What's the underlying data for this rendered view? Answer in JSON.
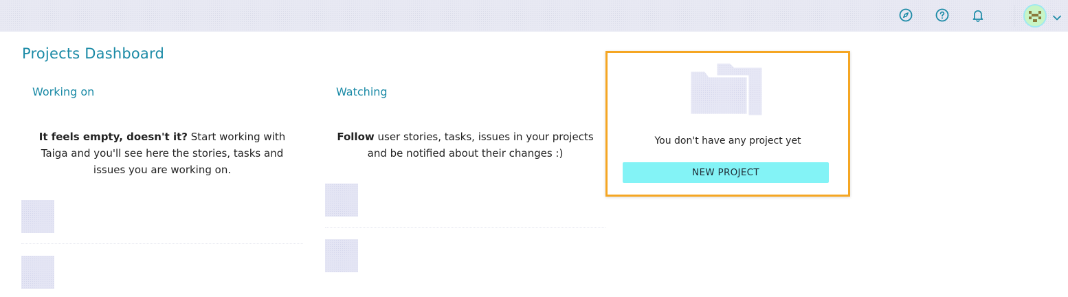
{
  "header": {
    "icons": [
      {
        "name": "discover-icon"
      },
      {
        "name": "help-icon"
      },
      {
        "name": "notifications-icon"
      }
    ],
    "avatar": {
      "name": "user-avatar"
    }
  },
  "page": {
    "title": "Projects Dashboard"
  },
  "working_on": {
    "title": "Working on",
    "empty_bold": "It feels empty, doesn't it?",
    "empty_text": " Start working with Taiga and you'll see here the stories, tasks and issues you are working on."
  },
  "watching": {
    "title": "Watching",
    "empty_bold": "Follow",
    "empty_text": " user stories, tasks, issues in your projects and be notified about their changes :)"
  },
  "projects_card": {
    "empty_text": "You don't have any project yet",
    "button_label": "NEW PROJECT",
    "highlight_color": "#f5a623",
    "button_color": "#83f3f6"
  },
  "colors": {
    "accent": "#1a8aa6",
    "nav_icon": "#1a8aa6"
  }
}
